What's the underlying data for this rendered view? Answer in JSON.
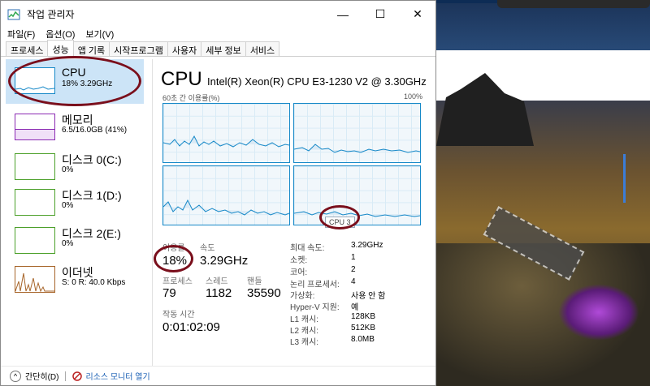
{
  "window": {
    "title": "작업 관리자",
    "minimize_glyph": "—",
    "maximize_glyph": "☐",
    "close_glyph": "✕"
  },
  "menu": [
    "파일(F)",
    "옵션(O)",
    "보기(V)"
  ],
  "tabs": [
    "프로세스",
    "성능",
    "앱 기록",
    "시작프로그램",
    "사용자",
    "세부 정보",
    "서비스"
  ],
  "active_tab": "성능",
  "resources": [
    {
      "name": "CPU",
      "sub": "18% 3.29GHz",
      "color": "#1789c8",
      "selected": true
    },
    {
      "name": "메모리",
      "sub": "6.5/16.0GB (41%)",
      "color": "#8b2ab3",
      "selected": false
    },
    {
      "name": "디스크 0(C:)",
      "sub": "0%",
      "color": "#4ca02a",
      "selected": false
    },
    {
      "name": "디스크 1(D:)",
      "sub": "0%",
      "color": "#4ca02a",
      "selected": false
    },
    {
      "name": "디스크 2(E:)",
      "sub": "0%",
      "color": "#4ca02a",
      "selected": false
    },
    {
      "name": "이더넷",
      "sub": "S: 0 R: 40.0 Kbps",
      "color": "#a7652a",
      "selected": false
    }
  ],
  "detail": {
    "title": "CPU",
    "model": "Intel(R) Xeon(R) CPU E3-1230 V2 @ 3.30GHz",
    "graph_label": "60초 간 이용률(%)",
    "graph_max": "100%",
    "tooltip": "CPU 3",
    "utilization_label": "이용률",
    "utilization": "18%",
    "speed_label": "속도",
    "speed": "3.29GHz",
    "processes_label": "프로세스",
    "processes": "79",
    "threads_label": "스레드",
    "threads": "1182",
    "handles_label": "핸들",
    "handles": "35590",
    "uptime_label": "작동 시간",
    "uptime": "0:01:02:09"
  },
  "properties": [
    {
      "label": "최대 속도:",
      "value": "3.29GHz"
    },
    {
      "label": "소켓:",
      "value": "1"
    },
    {
      "label": "코어:",
      "value": "2"
    },
    {
      "label": "논리 프로세서:",
      "value": "4"
    },
    {
      "label": "가상화:",
      "value": "사용 안 함"
    },
    {
      "label": "Hyper-V 지원:",
      "value": "예"
    },
    {
      "label": "L1 캐시:",
      "value": "128KB"
    },
    {
      "label": "L2 캐시:",
      "value": "512KB"
    },
    {
      "label": "L3 캐시:",
      "value": "8.0MB"
    }
  ],
  "footer": {
    "collapse": "간단히(D)",
    "resource_monitor": "리소스 모니터 열기"
  },
  "annotation_color": "#7a0f1c"
}
